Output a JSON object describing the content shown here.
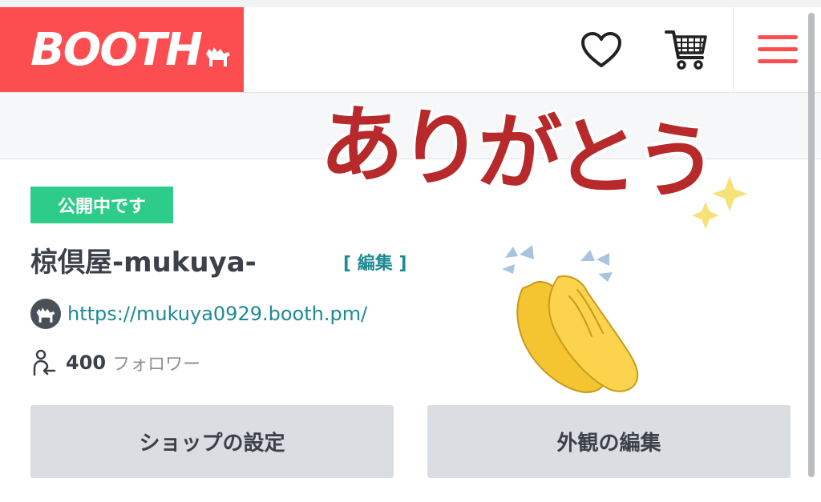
{
  "header": {
    "logo_text": "BOOTH",
    "icons": [
      "heart-icon",
      "cart-icon",
      "hamburger-menu-icon"
    ],
    "brand_color": "#fc4d50"
  },
  "shop": {
    "status_badge": "公開中です",
    "name": "椋倶屋-mukuya-",
    "edit_label": "[ 編集 ]",
    "url": "https://mukuya0929.booth.pm/",
    "follower_count": "400",
    "follower_label": "フォロワー"
  },
  "buttons": {
    "settings": "ショップの設定",
    "appearance": "外観の編集"
  },
  "sticker": {
    "text": "ありがとう",
    "emoji": "clapping-hands",
    "color": "#b7292a"
  },
  "colors": {
    "accent": "#1f8a93",
    "badge": "#2ecc8a",
    "button": "#dadde2"
  }
}
